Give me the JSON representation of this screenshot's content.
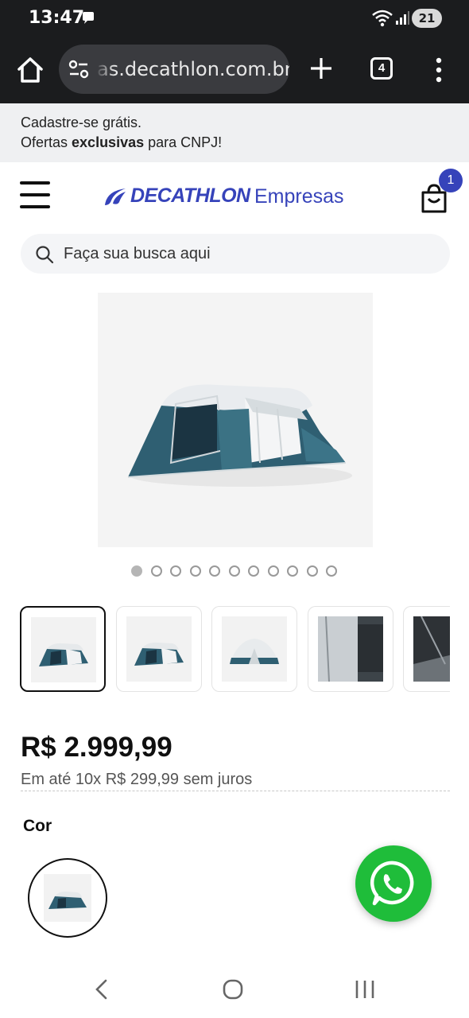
{
  "status_bar": {
    "time": "13:47",
    "battery": "21",
    "icons": [
      "chat-bubble-icon",
      "wifi-icon",
      "signal-icon",
      "battery-icon"
    ]
  },
  "browser": {
    "url": "as.decathlon.com.br",
    "tab_count": "4",
    "icons": [
      "home-icon",
      "site-settings-icon",
      "new-tab-icon",
      "more-vert-icon"
    ]
  },
  "promo": {
    "line1": "Cadastre-se grátis.",
    "line2_prefix": "Ofertas ",
    "line2_bold": "exclusivas",
    "line2_suffix": " para CNPJ!"
  },
  "header": {
    "brand": "DECATHLON",
    "brand_sub": "Empresas",
    "cart_count": "1",
    "brand_color": "#3643ba"
  },
  "search": {
    "placeholder": "Faça sua busca aqui"
  },
  "product": {
    "image_alt": "tent",
    "carousel_total": 11,
    "carousel_active": 1,
    "thumbnails": [
      "tent-thumb-1",
      "tent-thumb-2",
      "tent-thumb-3",
      "tent-thumb-4",
      "tent-thumb-5"
    ],
    "price": "R$ 2.999,99",
    "installments": "Em até 10x R$ 299,99 sem juros",
    "color_label": "Cor"
  },
  "fab": {
    "icon": "whatsapp-icon",
    "color": "#1fbd3a"
  },
  "nav_bar": {
    "icons": [
      "back-icon",
      "home-circle-icon",
      "recents-icon"
    ]
  }
}
